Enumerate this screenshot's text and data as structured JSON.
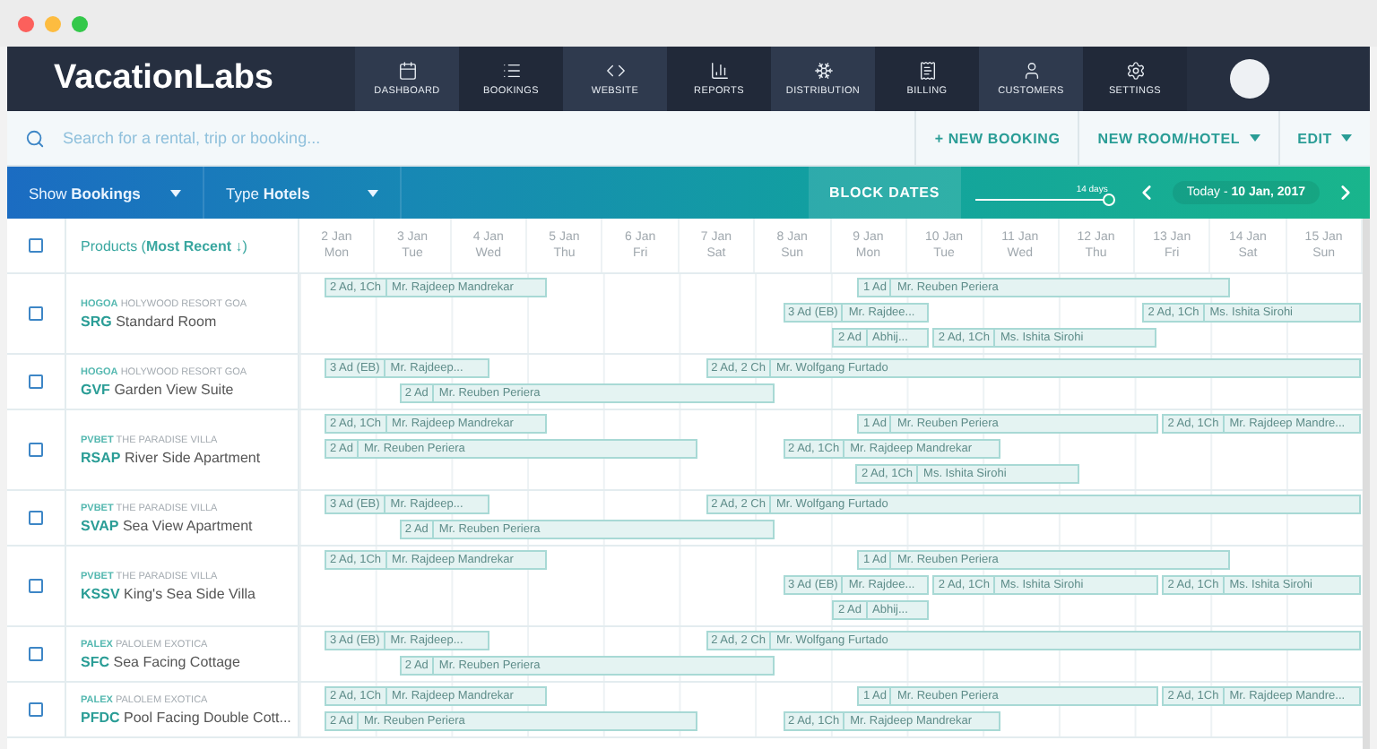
{
  "app": {
    "logo": "VacationLabs"
  },
  "nav": {
    "items": [
      {
        "label": "DASHBOARD"
      },
      {
        "label": "BOOKINGS"
      },
      {
        "label": "WEBSITE"
      },
      {
        "label": "REPORTS"
      },
      {
        "label": "DISTRIBUTION"
      },
      {
        "label": "BILLING"
      },
      {
        "label": "CUSTOMERS"
      },
      {
        "label": "SETTINGS"
      }
    ]
  },
  "search": {
    "placeholder": "Search for a rental, trip or booking..."
  },
  "actions": [
    {
      "label": "+ NEW BOOKING",
      "dropdown": false
    },
    {
      "label": "NEW ROOM/HOTEL",
      "dropdown": true
    },
    {
      "label": "EDIT",
      "dropdown": true
    }
  ],
  "filters": [
    {
      "label": "Show",
      "value": "Bookings"
    },
    {
      "label": "Type",
      "value": "Hotels"
    }
  ],
  "block_dates": "BLOCK DATES",
  "range": {
    "reading": "14 days",
    "level": 1
  },
  "today": {
    "label": "Today - ",
    "date": "10 Jan, 2017"
  },
  "table": {
    "checked": false,
    "products_label": "Products (",
    "sort": "Most Recent ↓",
    "sort_close": ")",
    "days": [
      {
        "date": "2 Jan",
        "weekday": "Mon"
      },
      {
        "date": "3 Jan",
        "weekday": "Tue"
      },
      {
        "date": "4 Jan",
        "weekday": "Wed"
      },
      {
        "date": "5 Jan",
        "weekday": "Thu"
      },
      {
        "date": "6 Jan",
        "weekday": "Fri"
      },
      {
        "date": "7 Jan",
        "weekday": "Sat"
      },
      {
        "date": "8 Jan",
        "weekday": "Sun"
      },
      {
        "date": "9 Jan",
        "weekday": "Mon"
      },
      {
        "date": "10 Jan",
        "weekday": "Tue"
      },
      {
        "date": "11 Jan",
        "weekday": "Wed"
      },
      {
        "date": "12 Jan",
        "weekday": "Thu"
      },
      {
        "date": "13 Jan",
        "weekday": "Fri"
      },
      {
        "date": "14 Jan",
        "weekday": "Sat"
      },
      {
        "date": "15 Jan",
        "weekday": "Sun"
      }
    ],
    "rows": [
      {
        "vendor_code": "HOGOA",
        "vendor_name": "HOLYWOOD RESORT GOA",
        "code": "SRG",
        "name": "Standard Room",
        "checked": false,
        "lanes": [
          [
            {
              "guests": "2 Ad, 1Ch",
              "guest": "Mr. Rajdeep Mandrekar"
            },
            {
              "guests": "1 Ad",
              "guest": "Mr. Reuben Periera"
            }
          ],
          [
            {
              "guests": "3 Ad (EB)",
              "guest": "Mr. Rajdee..."
            },
            {
              "guests": "2 Ad, 1Ch",
              "guest": "Ms. Ishita Sirohi"
            }
          ],
          [
            {
              "guests": "2 Ad",
              "guest": "Abhij..."
            },
            {
              "guests": "2 Ad, 1Ch",
              "guest": "Ms. Ishita Sirohi"
            }
          ]
        ]
      },
      {
        "vendor_code": "HOGOA",
        "vendor_name": "HOLYWOOD RESORT GOA",
        "code": "GVF",
        "name": "Garden View Suite",
        "checked": false,
        "lanes": [
          [
            {
              "guests": "3 Ad (EB)",
              "guest": "Mr. Rajdeep..."
            },
            {
              "guests": "2 Ad, 2 Ch",
              "guest": "Mr. Wolfgang Furtado"
            }
          ],
          [
            {
              "guests": "2 Ad",
              "guest": "Mr. Reuben Periera"
            }
          ]
        ]
      },
      {
        "vendor_code": "PVBET",
        "vendor_name": "THE PARADISE VILLA",
        "code": "RSAP",
        "name": "River Side Apartment",
        "checked": false,
        "lanes": [
          [
            {
              "guests": "2 Ad, 1Ch",
              "guest": "Mr. Rajdeep Mandrekar"
            },
            {
              "guests": "1 Ad",
              "guest": "Mr. Reuben Periera"
            },
            {
              "guests": "2 Ad, 1Ch",
              "guest": "Mr. Rajdeep Mandre..."
            }
          ],
          [
            {
              "guests": "2 Ad",
              "guest": "Mr. Reuben Periera"
            },
            {
              "guests": "2 Ad, 1Ch",
              "guest": "Mr. Rajdeep Mandrekar"
            }
          ],
          [
            {
              "guests": "2 Ad, 1Ch",
              "guest": "Ms. Ishita Sirohi"
            }
          ]
        ]
      },
      {
        "vendor_code": "PVBET",
        "vendor_name": "THE PARADISE VILLA",
        "code": "SVAP",
        "name": "Sea View Apartment",
        "checked": false,
        "lanes": [
          [
            {
              "guests": "3 Ad (EB)",
              "guest": "Mr. Rajdeep..."
            },
            {
              "guests": "2 Ad, 2 Ch",
              "guest": "Mr. Wolfgang Furtado"
            }
          ],
          [
            {
              "guests": "2 Ad",
              "guest": "Mr. Reuben Periera"
            }
          ]
        ]
      },
      {
        "vendor_code": "PVBET",
        "vendor_name": "THE PARADISE VILLA",
        "code": "KSSV",
        "name": "King's Sea Side Villa",
        "checked": false,
        "lanes": [
          [
            {
              "guests": "2 Ad, 1Ch",
              "guest": "Mr. Rajdeep Mandrekar"
            },
            {
              "guests": "1 Ad",
              "guest": "Mr. Reuben Periera"
            }
          ],
          [
            {
              "guests": "3 Ad (EB)",
              "guest": "Mr. Rajdee..."
            },
            {
              "guests": "2 Ad, 1Ch",
              "guest": "Ms. Ishita Sirohi"
            },
            {
              "guests": "2 Ad, 1Ch",
              "guest": "Ms. Ishita Sirohi"
            }
          ],
          [
            {
              "guests": "2 Ad",
              "guest": "Abhij..."
            }
          ]
        ]
      },
      {
        "vendor_code": "PALEX",
        "vendor_name": "PALOLEM EXOTICA",
        "code": "SFC",
        "name": "Sea Facing Cottage",
        "checked": false,
        "lanes": [
          [
            {
              "guests": "3 Ad (EB)",
              "guest": "Mr. Rajdeep..."
            },
            {
              "guests": "2 Ad, 2 Ch",
              "guest": "Mr. Wolfgang Furtado"
            }
          ],
          [
            {
              "guests": "2 Ad",
              "guest": "Mr. Reuben Periera"
            }
          ]
        ]
      },
      {
        "vendor_code": "PALEX",
        "vendor_name": "PALOLEM EXOTICA",
        "code": "PFDC",
        "name": "Pool Facing Double Cott...",
        "checked": false,
        "lanes": [
          [
            {
              "guests": "2 Ad, 1Ch",
              "guest": "Mr. Rajdeep Mandrekar"
            },
            {
              "guests": "1 Ad",
              "guest": "Mr. Reuben Periera"
            },
            {
              "guests": "2 Ad, 1Ch",
              "guest": "Mr. Rajdeep Mandre..."
            }
          ],
          [
            {
              "guests": "2 Ad",
              "guest": "Mr. Reuben Periera"
            },
            {
              "guests": "2 Ad, 1Ch",
              "guest": "Mr. Rajdeep Mandrekar"
            }
          ]
        ]
      }
    ]
  }
}
